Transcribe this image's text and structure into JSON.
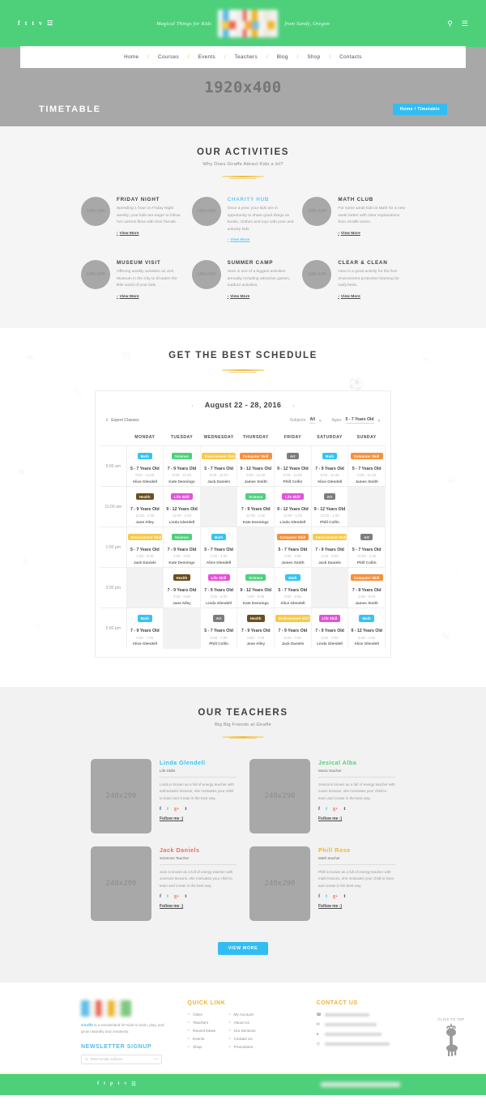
{
  "topbar": {
    "social": [
      "f",
      "t",
      "t",
      "v",
      "☳"
    ],
    "tagline_left": "Magical Things for Kids",
    "tagline_right": "from Sandy, Oregon",
    "search_icon": "search-icon",
    "menu_icon": "hamburger-icon"
  },
  "nav": {
    "items": [
      "Home",
      "Courses",
      "Events",
      "Teachers",
      "Blog",
      "Shop",
      "Contacts"
    ],
    "separator": "/"
  },
  "hero": {
    "placeholder": "1920x400",
    "title": "TIMETABLE",
    "breadcrumb": "Home / Timetable"
  },
  "activities": {
    "title": "OUR ACTIVITIES",
    "subtitle": "Why Does Giraffe Attract Kids a lot?",
    "thumb_placeholder": "100x100",
    "more_label": "View More",
    "items": [
      {
        "name": "FRIDAY NIGHT",
        "desc": "Spending 1 hour on Friday Night weekly, your kids are eager to follow hot cartoon films with their friends.",
        "highlight": false
      },
      {
        "name": "CHARITY HUB",
        "desc": "Once a year, your kids are in opportunity to share good things as books, clothes and toys with poor and unlucky kids.",
        "highlight": true
      },
      {
        "name": "MATH CLUB",
        "desc": "For some weak kids at Math for a new week better with clear explanations from Giraffe tutors.",
        "highlight": false
      },
      {
        "name": "MUSEUM VISIT",
        "desc": "Offering weekly activities as visit Museum in the City to broaden the little world of your kids.",
        "highlight": false
      },
      {
        "name": "SUMMER CAMP",
        "desc": "Here is one of a biggest activities annually including attractive games, outdoor activities.",
        "highlight": false
      },
      {
        "name": "CLEAR & CLEAN",
        "desc": "Here is a good activity for the first environment protection learning for early birds.",
        "highlight": false
      }
    ]
  },
  "schedule": {
    "title": "GET THE BEST SCHEDULE",
    "date_range": "August 22 - 28, 2016",
    "prev_label": "‹",
    "next_label": "›",
    "export_label": "Export Classes",
    "filters": [
      {
        "label": "Subjects:",
        "value": "All"
      },
      {
        "label": "Ages:",
        "value": "5 - 7 Years Old"
      }
    ],
    "days": [
      "MONDAY",
      "TUESDAY",
      "WEDNESDAY",
      "THURSDAY",
      "FRIDAY",
      "SATURDAY",
      "SUNDAY"
    ],
    "times": [
      "9:00 am",
      "11:00 am",
      "1:00 pm",
      "3:00 pm",
      "5:00 pm"
    ],
    "subject_colors": {
      "Math": "#35c3f3",
      "Science": "#4ed07b",
      "Environment Skill": "#f7c948",
      "Computer Skill": "#f5903c",
      "Art": "#7c7c7c",
      "Health": "#6b4f1d",
      "Life Skill": "#e452d8"
    },
    "rows": [
      {
        "time": "9:00 am",
        "cells": [
          {
            "subject": "Math",
            "age": "5 - 7 Years Old",
            "time": "9:00 - 11:00",
            "teacher": "Alice Glendell"
          },
          {
            "subject": "Science",
            "age": "7 - 9 Years Old",
            "time": "9:00 - 11:00",
            "teacher": "Kate Dennings"
          },
          {
            "subject": "Environment Skill",
            "age": "5 - 7 Years Old",
            "time": "9:00 - 11:00",
            "teacher": "Jack Daniels"
          },
          {
            "subject": "Computer Skill",
            "age": "9 - 12 Years Old",
            "time": "9:00 - 11:00",
            "teacher": "James Smith"
          },
          {
            "subject": "Art",
            "age": "9 - 12 Years Old",
            "time": "9:00 - 11:00",
            "teacher": "Phill Collin"
          },
          {
            "subject": "Math",
            "age": "7 - 9 Years Old",
            "time": "9:00 - 11:00",
            "teacher": "Alice Glendell"
          },
          {
            "subject": "Computer Skill",
            "age": "5 - 7 Years Old",
            "time": "9:00 - 11:00",
            "teacher": "James Smith"
          }
        ]
      },
      {
        "time": "11:00 am",
        "cells": [
          {
            "subject": "Health",
            "age": "7 - 9 Years Old",
            "time": "11:00 - 1:00",
            "teacher": "Jane Alley"
          },
          {
            "subject": "Life Skill",
            "age": "9 - 12 Years Old",
            "time": "11:00 - 1:00",
            "teacher": "Linda Glendell"
          },
          null,
          {
            "subject": "Science",
            "age": "7 - 9 Years Old",
            "time": "11:00 - 1:00",
            "teacher": "Kate Dennings"
          },
          {
            "subject": "Life Skill",
            "age": "9 - 12 Years Old",
            "time": "11:00 - 1:00",
            "teacher": "Linda Glendell"
          },
          {
            "subject": "Art",
            "age": "9 - 12 Years Old",
            "time": "11:00 - 1:00",
            "teacher": "Phill Collin"
          },
          null
        ]
      },
      {
        "time": "1:00 pm",
        "cells": [
          {
            "subject": "Environment Skill",
            "age": "5 - 7 Years Old",
            "time": "1:00 - 3:00",
            "teacher": "Jack Daniels"
          },
          {
            "subject": "Science",
            "age": "7 - 9 Years Old",
            "time": "1:00 - 3:00",
            "teacher": "Kate Dennings"
          },
          {
            "subject": "Math",
            "age": "5 - 7 Years Old",
            "time": "1:00 - 3:00",
            "teacher": "Alice Glendell"
          },
          null,
          {
            "subject": "Computer Skill",
            "age": "5 - 7 Years Old",
            "time": "1:00 - 3:00",
            "teacher": "James Smith"
          },
          {
            "subject": "Environment Skill",
            "age": "7 - 9 Years Old",
            "time": "1:00 - 3:00",
            "teacher": "Jack Daniels"
          },
          {
            "subject": "Art",
            "age": "5 - 7 Years Old",
            "time": "11:00 - 1:00",
            "teacher": "Phill Collin"
          }
        ]
      },
      {
        "time": "3:00 pm",
        "cells": [
          null,
          {
            "subject": "Health",
            "age": "7 - 9 Years Old",
            "time": "3:00 - 5:00",
            "teacher": "Jane Alley"
          },
          {
            "subject": "Life Skill",
            "age": "7 - 9 Years Old",
            "time": "3:00 - 5:00",
            "teacher": "Linda Glendell"
          },
          {
            "subject": "Science",
            "age": "9 - 12 Years Old",
            "time": "3:00 - 5:00",
            "teacher": "Kate Dennings"
          },
          {
            "subject": "Math",
            "age": "5 - 7 Years Old",
            "time": "3:00 - 5:00",
            "teacher": "Alice Glendell"
          },
          null,
          {
            "subject": "Computer Skill",
            "age": "7 - 9 Years Old",
            "time": "3:00 - 5:00",
            "teacher": "James Smith"
          }
        ]
      },
      {
        "time": "5:00 pm",
        "cells": [
          {
            "subject": "Math",
            "age": "7 - 9 Years Old",
            "time": "5:00 - 7:00",
            "teacher": "Alice Glendell"
          },
          null,
          {
            "subject": "Art",
            "age": "5 - 7 Years Old",
            "time": "5:00 - 7:00",
            "teacher": "Phill Collin"
          },
          {
            "subject": "Health",
            "age": "7 - 9 Years Old",
            "time": "5:00 - 7:00",
            "teacher": "Jane Alley"
          },
          {
            "subject": "Environment Skill",
            "age": "7 - 9 Years Old",
            "time": "5:00 - 7:00",
            "teacher": "Jack Daniels"
          },
          {
            "subject": "Life Skill",
            "age": "7 - 9 Years Old",
            "time": "5:00 - 7:00",
            "teacher": "Linda Glendell"
          },
          {
            "subject": "Math",
            "age": "9 - 12 Years Old",
            "time": "5:00 - 7:00",
            "teacher": "Alice Glendell"
          }
        ]
      }
    ]
  },
  "teachers": {
    "title": "OUR TEACHERS",
    "subtitle": "Big Big Friends at Giraffe",
    "photo_placeholder": "240x290",
    "follow_label": "Follow me :)",
    "social": [
      "f",
      "t",
      "g+",
      "t"
    ],
    "view_more": "VIEW MORE",
    "items": [
      {
        "name": "Linda Glendell",
        "color": "#35c3f3",
        "role": "Life Skills",
        "bio": "Linda is known as a full of energy teacher with enthusiastic lessons, she motivates your child to learn and create in the best way."
      },
      {
        "name": "Jesical Alba",
        "color": "#4ed07b",
        "role": "Music teacher",
        "bio": "Jesical is known as a full of energy teacher with music lessons, she motivates your child to learn and create in the best way."
      },
      {
        "name": "Jack Daniels",
        "color": "#f06a5a",
        "role": "Sciences Teacher",
        "bio": "Jack is known as a full of energy teacher with sciences lessons, she motivates your child to learn and create in the best way."
      },
      {
        "name": "Phill Rose",
        "color": "#f0b429",
        "role": "Math teacher",
        "bio": "Phill is known as a full of energy teacher with math lessons, she motivates your child to learn and create in the best way."
      }
    ]
  },
  "footer": {
    "about_brand": "Giraffe",
    "about_text": " is a wonderland for Kids to learn, play, and grow naturally and creatively.",
    "newsletter_title": "NEWSLETTER SIGNUP",
    "newsletter_placeholder": "Enter Email Address",
    "quick_link_title": "QUICK LINK",
    "quick_links_col1": [
      "Class",
      "Teachers",
      "Recent News",
      "Events",
      "Shop"
    ],
    "quick_links_col2": [
      "My Account",
      "About Us",
      "Our Services",
      "Contact Us",
      "Promotions"
    ],
    "contact_title": "CONTACT US",
    "contact_icons": [
      "phone-icon",
      "mail-icon",
      "pin-icon",
      "clock-icon"
    ],
    "to_top_label": "CLICK TO TOP",
    "bottom_social": [
      "f",
      "t",
      "p",
      "t",
      "v",
      "☳"
    ]
  }
}
